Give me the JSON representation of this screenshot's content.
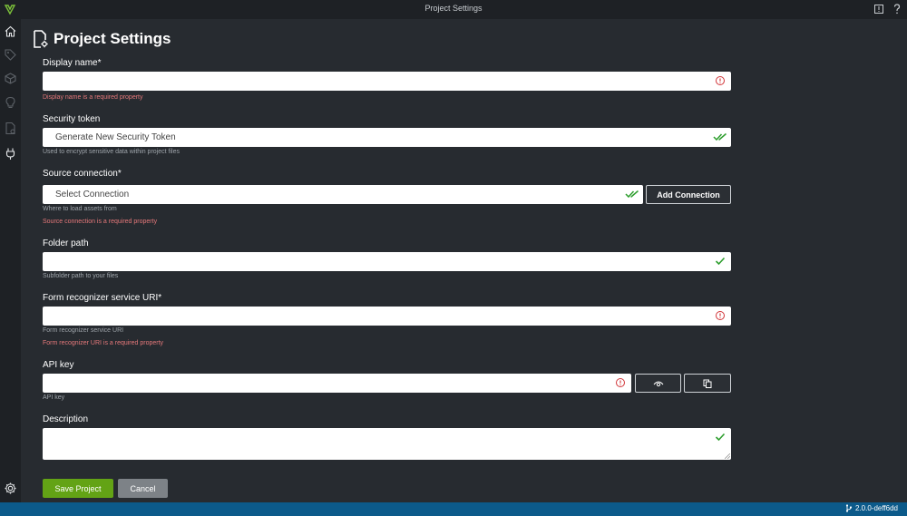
{
  "window": {
    "title": "Project Settings"
  },
  "page": {
    "title": "Project Settings"
  },
  "fields": {
    "display_name": {
      "label": "Display name*",
      "value": "",
      "error": "Display name is a required property"
    },
    "security_token": {
      "label": "Security token",
      "value": "Generate New Security Token",
      "help": "Used to encrypt sensitive data within project files"
    },
    "source_connection": {
      "label": "Source connection*",
      "value": "Select Connection",
      "help": "Where to load assets from",
      "error": "Source connection is a required property",
      "add_label": "Add Connection"
    },
    "folder_path": {
      "label": "Folder path",
      "value": "",
      "help": "Subfolder path to your files"
    },
    "form_recognizer_uri": {
      "label": "Form recognizer service URI*",
      "value": "",
      "help": "Form recognizer service URI",
      "error": "Form recognizer URI is a required property"
    },
    "api_key": {
      "label": "API key",
      "value": "",
      "help": "API key"
    },
    "description": {
      "label": "Description",
      "value": ""
    }
  },
  "actions": {
    "save_label": "Save Project",
    "cancel_label": "Cancel"
  },
  "statusbar": {
    "version": "2.0.0-deff6dd"
  },
  "icons": {
    "sidebar": [
      "home-icon",
      "tag-icon",
      "model-icon",
      "lightbulb-icon",
      "document-settings-icon",
      "plug-icon",
      "settings-gear-icon"
    ],
    "status_error": "error-circle-icon",
    "status_ok": "checkmark-icon"
  },
  "colors": {
    "accent": "#63a315",
    "error": "#e5787a",
    "ok": "#2e9e2e",
    "status_bar": "#0c5a8a"
  }
}
